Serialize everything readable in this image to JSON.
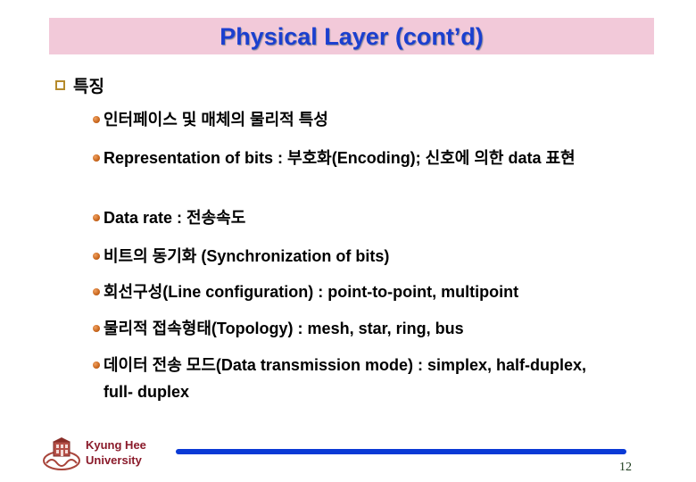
{
  "slide": {
    "title": "Physical Layer (cont’d)",
    "section_heading": "특징",
    "bullets": [
      {
        "text": "인터페이스 및 매체의 물리적 특성"
      },
      {
        "text": "Representation of bits : 부호화(Encoding); 신호에 의한 data 표현"
      },
      {
        "text": "Data rate : 전송속도"
      },
      {
        "text": "비트의 동기화 (Synchronization of bits)"
      },
      {
        "text": "회선구성(Line configuration) : point-to-point, multipoint"
      },
      {
        "text": "물리적 접속형태(Topology) : mesh, star, ring, bus"
      },
      {
        "text": "데이터 전송 모드(Data transmission mode) : simplex, half-duplex, full- duplex"
      }
    ]
  },
  "footer": {
    "university_line1": "Kyung Hee",
    "university_line2": "University",
    "logo_icon": "university-seal-icon",
    "page_number": "12"
  },
  "colors": {
    "title_text": "#1b3fcf",
    "title_band": "#f2c9d9",
    "bullet": "#c8661c",
    "square_bullet": "#b58a2c",
    "university_text": "#8a1a2a",
    "footer_rule": "#0a3ad6"
  }
}
